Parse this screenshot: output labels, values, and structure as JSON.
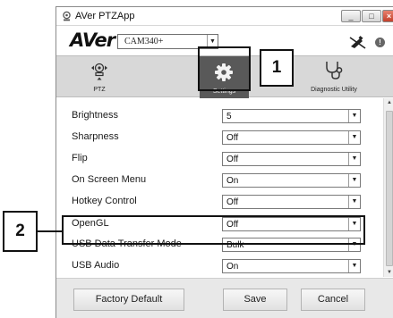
{
  "window": {
    "title": "AVer PTZApp",
    "controls": [
      "_",
      "□",
      "×"
    ]
  },
  "header": {
    "logo": "AVer",
    "camera_select": "CAM340+"
  },
  "nav": {
    "tabs": [
      {
        "label": "PTZ"
      },
      {
        "label": "Settings"
      },
      {
        "label": "Diagnostic Utility"
      }
    ]
  },
  "settings": [
    {
      "label": "Brightness",
      "value": "5"
    },
    {
      "label": "Sharpness",
      "value": "Off"
    },
    {
      "label": "Flip",
      "value": "Off"
    },
    {
      "label": "On Screen Menu",
      "value": "On"
    },
    {
      "label": "Hotkey Control",
      "value": "Off"
    },
    {
      "label": "OpenGL",
      "value": "Off"
    },
    {
      "label": "USB Data Transfer Mode",
      "value": "Bulk"
    },
    {
      "label": "USB Audio",
      "value": "On"
    }
  ],
  "buttons": {
    "factory_default": "Factory Default",
    "save": "Save",
    "cancel": "Cancel"
  },
  "callouts": {
    "one": "1",
    "two": "2"
  }
}
